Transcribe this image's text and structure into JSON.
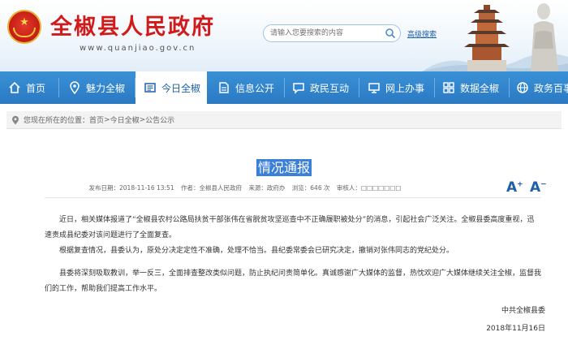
{
  "header": {
    "site_title": "全椒县人民政府",
    "site_url": "www.quanjiao.gov.cn",
    "search_placeholder": "请输入您要搜索的内容",
    "advanced_search": "高级搜索"
  },
  "nav": {
    "items": [
      {
        "label": "首页",
        "icon": "home-icon"
      },
      {
        "label": "魅力全椒",
        "icon": "location-pin-icon"
      },
      {
        "label": "今日全椒",
        "icon": "news-icon",
        "active": true
      },
      {
        "label": "信息公开",
        "icon": "document-icon"
      },
      {
        "label": "政民互动",
        "icon": "chat-icon"
      },
      {
        "label": "网上办事",
        "icon": "monitor-icon"
      },
      {
        "label": "数据全椒",
        "icon": "grid-icon"
      },
      {
        "label": "政务百事",
        "icon": "globe-icon"
      }
    ]
  },
  "breadcrumb": {
    "prefix": "您现在所在的位置：",
    "items": [
      "首页",
      "今日全椒",
      "公告公示"
    ],
    "separator": " > "
  },
  "article": {
    "title": "情况通报",
    "meta": {
      "published": "发布日期：2018-11-16 13:51",
      "author": "作者：全椒县人民政府",
      "source": "来源：政府办",
      "views": "浏览：646 次",
      "reviewer": "审核人：□□□□□□□"
    },
    "font_increase": "A",
    "font_decrease": "A",
    "paragraphs": [
      "近日，相关媒体报道了“全椒县农村公路局扶贫干部张伟在省脱贫攻坚巡查中不正确履职被处分”的消息，引起社会广泛关注。全椒县委高度重视，迅速责成县纪委对该问题进行了全面复查。",
      "根据复查情况，县委认为，原处分决定定性不准确，处理不恰当。县纪委常委会已研究决定，撤销对张伟同志的党纪处分。",
      "县委将深刻吸取教训，举一反三，全面排查整改类似问题，防止执纪问责简单化。真诚感谢广大媒体的监督，热忱欢迎广大媒体继续关注全椒，监督我们的工作，帮助我们提高工作水平。"
    ],
    "signature": "中共全椒县委",
    "date": "2018年11月16日"
  },
  "colors": {
    "title_red": "#d11b1b",
    "nav_blue": "#2a79c2",
    "highlight_blue": "#3a7fd8"
  }
}
